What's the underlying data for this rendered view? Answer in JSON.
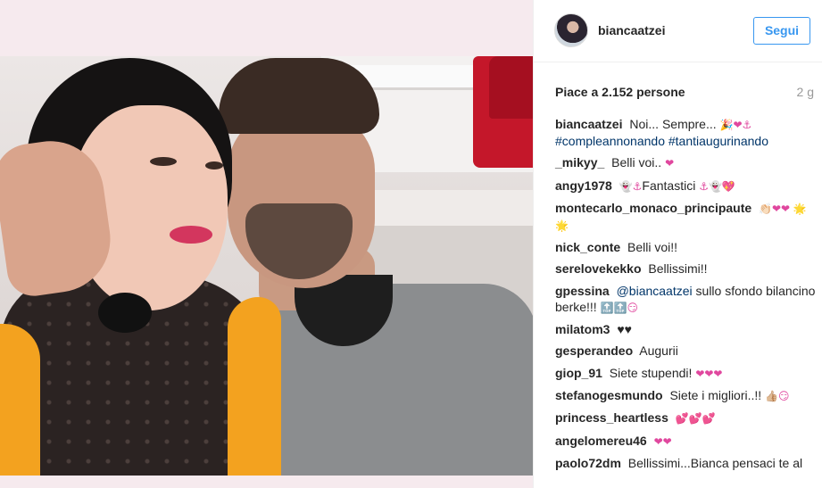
{
  "post": {
    "username": "biancaatzei",
    "follow_label": "Segui",
    "likes_text": "Piace a 2.152 persone",
    "age": "2 g"
  },
  "comments": [
    {
      "user": "biancaatzei",
      "text": "Noi... Sempre...",
      "emoji": "🎉❤⚓",
      "tags": "#compleannonando #tantiaugurinando"
    },
    {
      "user": "_mikyy_",
      "text": "Belli voi..",
      "emoji": "❤"
    },
    {
      "user": "angy1978",
      "text": "Fantastici",
      "emoji_pre": "👻⚓",
      "emoji": "⚓👻💖"
    },
    {
      "user": "montecarlo_monaco_principaute",
      "text": "",
      "emoji": "👏🏻❤❤ 🌟🌟"
    },
    {
      "user": "nick_conte",
      "text": "Belli voi!!",
      "emoji": ""
    },
    {
      "user": "serelovekekko",
      "text": "Bellissimi!!",
      "emoji": ""
    },
    {
      "user": "gpessina",
      "mention": "@biancaatzei",
      "text": "sullo sfondo bilancino berke!!!",
      "emoji": "🔝🔝😏"
    },
    {
      "user": "milatom3",
      "text": "♥♥",
      "emoji": ""
    },
    {
      "user": "gesperandeo",
      "text": "Augurii",
      "emoji": ""
    },
    {
      "user": "giop_91",
      "text": "Siete stupendi!",
      "emoji": "❤❤❤"
    },
    {
      "user": "stefanogesmundo",
      "text": "Siete i migliori..!!",
      "emoji": "👍🏼😏"
    },
    {
      "user": "princess_heartless",
      "text": "",
      "emoji": "💕💕💕"
    },
    {
      "user": "angelomereu46",
      "text": "",
      "emoji": "❤❤"
    },
    {
      "user": "paolo72dm",
      "text": "Bellissimi...Bianca pensaci te al",
      "emoji": ""
    }
  ],
  "colors": {
    "accent": "#3897f0",
    "hashtag": "#003569",
    "muted": "#999999"
  }
}
